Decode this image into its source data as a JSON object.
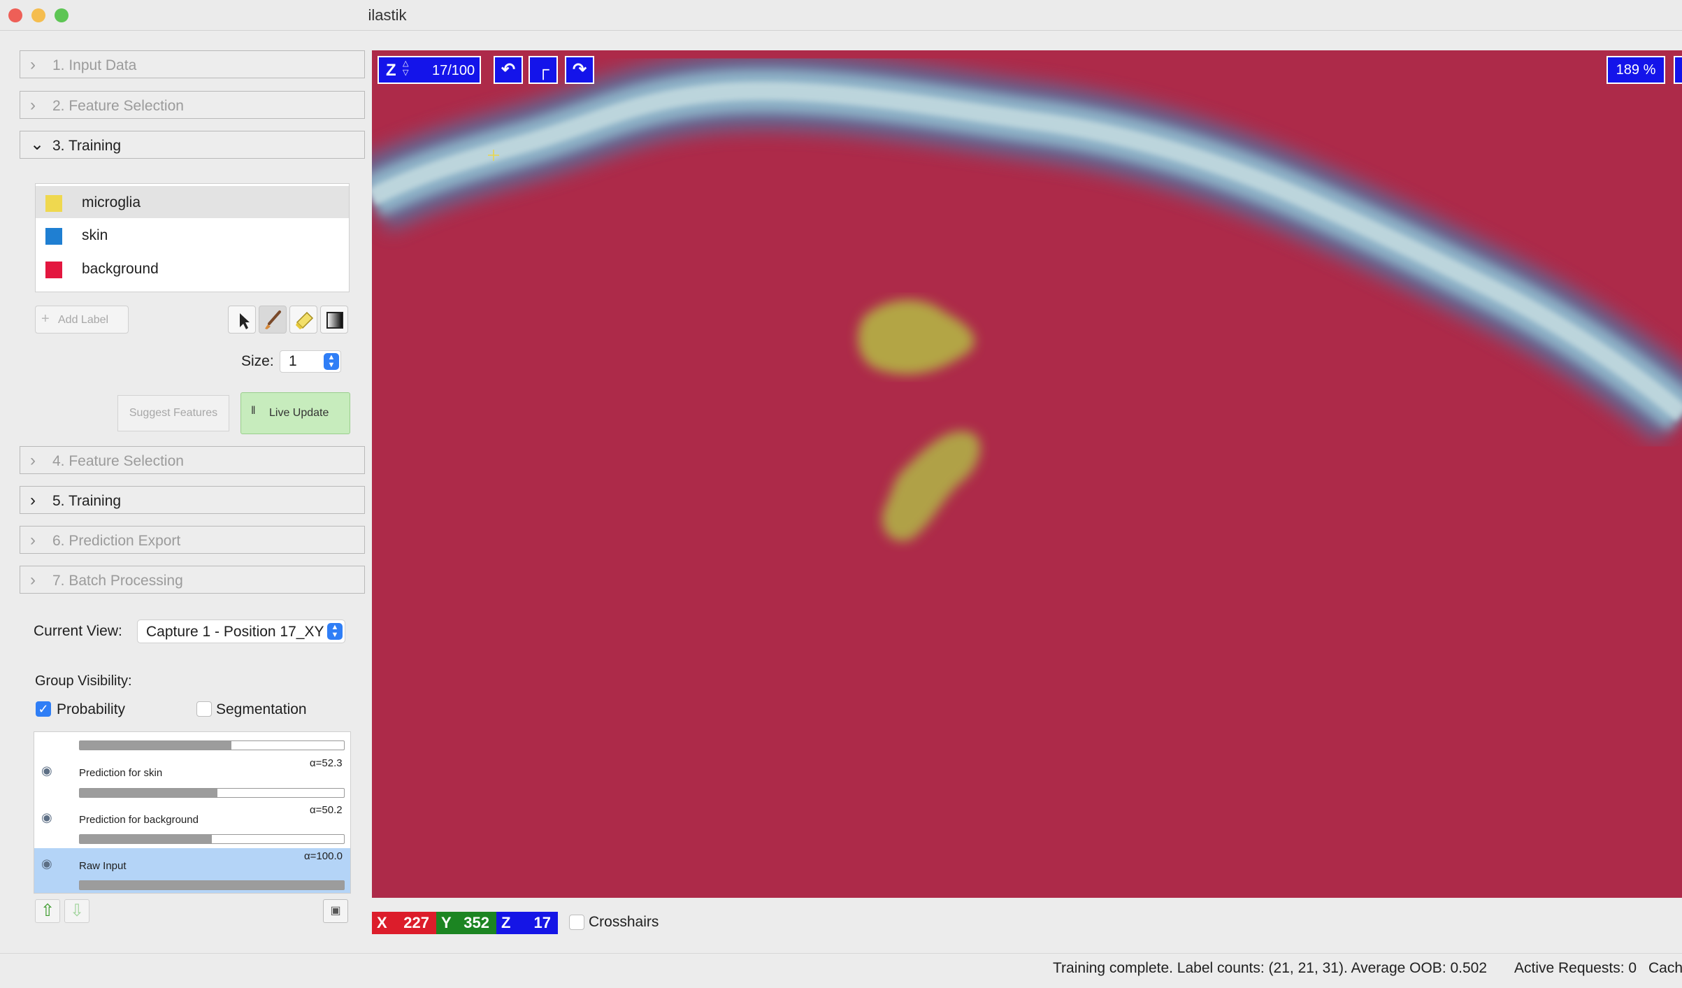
{
  "window": {
    "title": "ilastik"
  },
  "applets": [
    {
      "label": "1. Input Data"
    },
    {
      "label": "2. Feature Selection"
    },
    {
      "label": "3. Training"
    },
    {
      "label": "4. Feature Selection"
    },
    {
      "label": "5. Training"
    },
    {
      "label": "6. Prediction Export"
    },
    {
      "label": "7. Batch Processing"
    }
  ],
  "labels": [
    {
      "name": "microglia",
      "color": "#efd84f"
    },
    {
      "name": "skin",
      "color": "#1f7fd2"
    },
    {
      "name": "background",
      "color": "#e3173f"
    }
  ],
  "tools": {
    "add_label": "Add Label",
    "size_label": "Size:",
    "size_value": "1",
    "suggest_features": "Suggest Features",
    "live_update": "Live Update"
  },
  "view": {
    "current_view_label": "Current View:",
    "current_view_value": "Capture 1 - Position 17_XY"
  },
  "group_visibility": {
    "label": "Group Visibility:",
    "probability": {
      "label": "Probability",
      "checked": true
    },
    "segmentation": {
      "label": "Segmentation",
      "checked": false
    }
  },
  "layers": [
    {
      "name": "Prediction for skin",
      "alpha": "α=52.3",
      "opacity": 0.523
    },
    {
      "name": "Prediction for background",
      "alpha": "α=50.2",
      "opacity": 0.502
    },
    {
      "name": "Raw Input",
      "alpha": "α=100.0",
      "opacity": 1.0
    }
  ],
  "top_layer_opacity": 0.57,
  "viewer": {
    "z_label": "Z",
    "slice": "17/100",
    "zoom": "189 %"
  },
  "coords": {
    "x_label": "X",
    "x": "227",
    "y_label": "Y",
    "y": "352",
    "z_label": "Z",
    "z": "17",
    "crosshairs_label": "Crosshairs"
  },
  "status": {
    "message": "Training complete. Label counts: (21, 21, 31). Average OOB: 0.502",
    "requests": "Active Requests: 0",
    "cache": "Cach"
  }
}
